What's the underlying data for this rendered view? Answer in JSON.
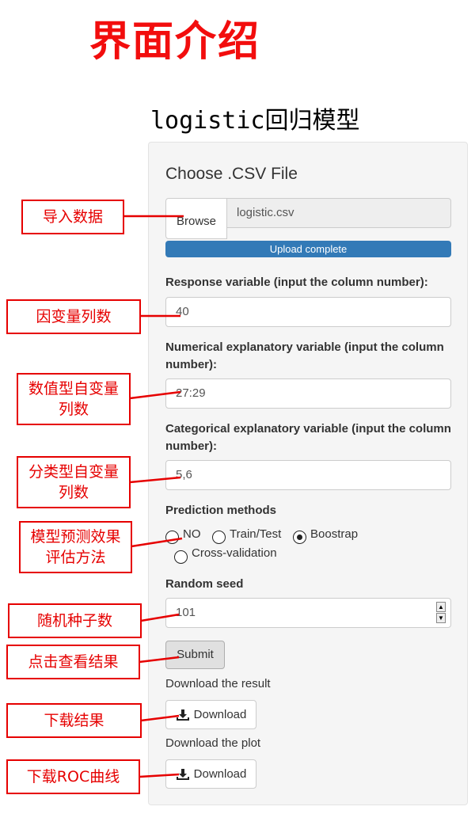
{
  "heading": "界面介绍",
  "subtitle": "logistic回归模型",
  "form": {
    "file_title": "Choose .CSV File",
    "browse_label": "Browse",
    "file_name": "logistic.csv",
    "progress_text": "Upload complete",
    "progress_value": 1.0,
    "response_label": "Response variable (input the column number):",
    "response_value": "40",
    "numerical_label": "Numerical explanatory variable (input the column number):",
    "numerical_value": "27:29",
    "categorical_label": "Categorical explanatory variable (input the column number):",
    "categorical_value": "5,6",
    "prediction_label": "Prediction methods",
    "prediction_options": [
      "NO",
      "Train/Test",
      "Boostrap",
      "Cross-validation"
    ],
    "prediction_selected": "Boostrap",
    "seed_label": "Random seed",
    "seed_value": "101",
    "submit_label": "Submit",
    "download_result_note": "Download the result",
    "download_result_label": "Download",
    "download_plot_note": "Download the plot",
    "download_plot_label": "Download"
  },
  "annotations": [
    "导入数据",
    "因变量列数",
    "数值型自变量列数",
    "分类型自变量列数",
    "模型预测效果评估方法",
    "随机种子数",
    "点击查看结果",
    "下载结果",
    "下载ROC曲线"
  ],
  "colors": {
    "annotation": "#e60000",
    "heading": "#f20d0d",
    "progress": "#337ab7",
    "panel": "#f5f5f5"
  },
  "icons": [
    "download-icon",
    "spinner-up-icon",
    "spinner-down-icon"
  ]
}
